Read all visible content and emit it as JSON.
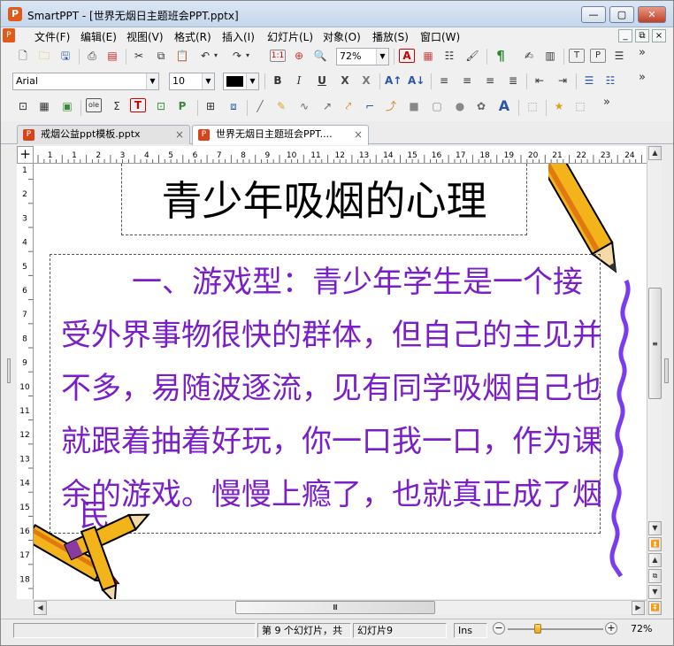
{
  "window": {
    "app_icon": "P",
    "title": "SmartPPT - [世界无烟日主题班会PPT.pptx]",
    "min_label": "—",
    "max_label": "▢",
    "close_label": "✕"
  },
  "menu": {
    "items": [
      "文件(F)",
      "编辑(E)",
      "视图(V)",
      "格式(R)",
      "插入(I)",
      "幻灯片(L)",
      "对象(O)",
      "播放(S)",
      "窗口(W)"
    ],
    "mdi_buttons": [
      "_",
      "⧉",
      "×"
    ]
  },
  "toolbar_standard": {
    "zoom_value": "72%",
    "icons": [
      "new-icon",
      "open-icon",
      "save-icon",
      "print-icon",
      "pdf-icon",
      "cut-icon",
      "copy-icon",
      "paste-icon",
      "undo-icon",
      "redo-icon",
      "slide-layout-icon",
      "find-icon",
      "zoom-icon",
      "text-color-icon",
      "chart-icon",
      "table-icon",
      "brush-icon",
      "pilcrow-icon",
      "signature-icon",
      "stats-icon",
      "template-icon",
      "present-icon",
      "more-icon"
    ]
  },
  "toolbar_format": {
    "font_value": "Arial",
    "size_value": "10",
    "color_value": "#000000"
  },
  "tabs": [
    {
      "label": "戒烟公益ppt模板.pptx",
      "close": "×"
    },
    {
      "label": "世界无烟日主题班会PPT....",
      "close": "×"
    }
  ],
  "ruler": {
    "corner": "+",
    "h_ticks": [
      "1",
      "1",
      "2",
      "3",
      "4",
      "5",
      "6",
      "7",
      "8",
      "9",
      "10",
      "11",
      "12",
      "13",
      "14",
      "15",
      "16",
      "17",
      "18",
      "19",
      "20",
      "21",
      "22",
      "23",
      "24",
      "25"
    ],
    "v_ticks": [
      "1",
      "2",
      "3",
      "4",
      "5",
      "6",
      "7",
      "8",
      "9",
      "10",
      "11",
      "12",
      "13",
      "14",
      "15",
      "16",
      "17",
      "18"
    ]
  },
  "slide": {
    "title": "青少年吸烟的心理",
    "body": "一、游戏型：青少年学生是一个接受外界事物很快的群体，但自己的主见并不多，易随波逐流，见有同学吸烟自己也就跟着抽着好玩，你一口我一口，作为课余的游戏。慢慢上瘾了，也就真正成了烟",
    "body_tail": "民",
    "text_color": "#7a1fc8"
  },
  "scroll": {
    "h_thumb": "Ⅲ",
    "v_thumb": "≡"
  },
  "status": {
    "slide_info": "第 9 个幻灯片，共",
    "slide_name": "幻灯片9",
    "mode": "Ins",
    "zoom": "72%"
  }
}
